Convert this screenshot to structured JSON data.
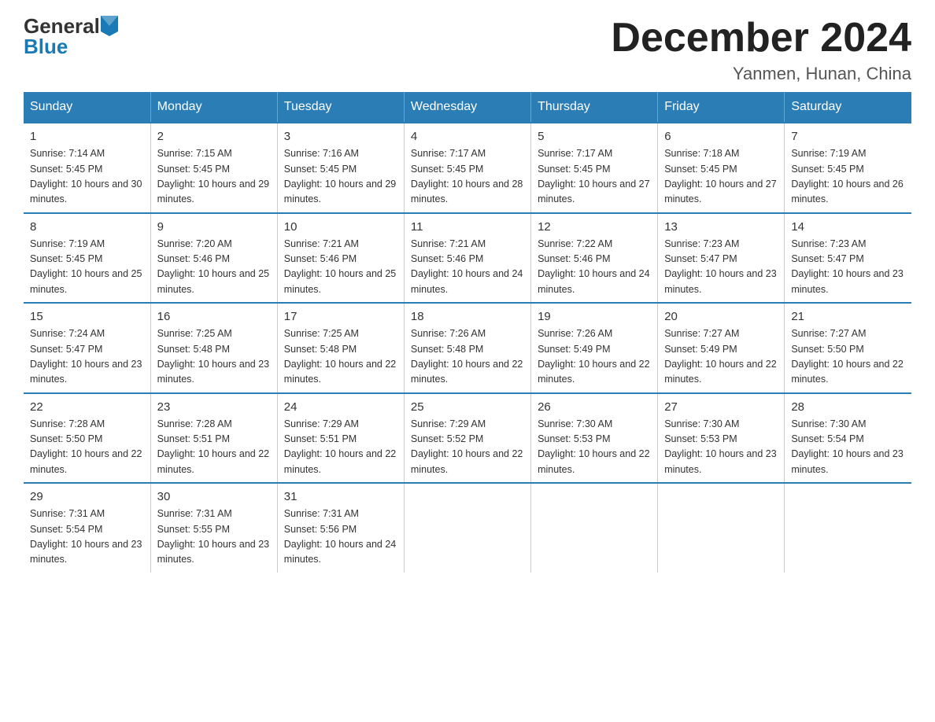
{
  "header": {
    "logo_general": "General",
    "logo_blue": "Blue",
    "main_title": "December 2024",
    "subtitle": "Yanmen, Hunan, China"
  },
  "days_of_week": [
    "Sunday",
    "Monday",
    "Tuesday",
    "Wednesday",
    "Thursday",
    "Friday",
    "Saturday"
  ],
  "weeks": [
    [
      {
        "day": "1",
        "sunrise": "7:14 AM",
        "sunset": "5:45 PM",
        "daylight": "10 hours and 30 minutes."
      },
      {
        "day": "2",
        "sunrise": "7:15 AM",
        "sunset": "5:45 PM",
        "daylight": "10 hours and 29 minutes."
      },
      {
        "day": "3",
        "sunrise": "7:16 AM",
        "sunset": "5:45 PM",
        "daylight": "10 hours and 29 minutes."
      },
      {
        "day": "4",
        "sunrise": "7:17 AM",
        "sunset": "5:45 PM",
        "daylight": "10 hours and 28 minutes."
      },
      {
        "day": "5",
        "sunrise": "7:17 AM",
        "sunset": "5:45 PM",
        "daylight": "10 hours and 27 minutes."
      },
      {
        "day": "6",
        "sunrise": "7:18 AM",
        "sunset": "5:45 PM",
        "daylight": "10 hours and 27 minutes."
      },
      {
        "day": "7",
        "sunrise": "7:19 AM",
        "sunset": "5:45 PM",
        "daylight": "10 hours and 26 minutes."
      }
    ],
    [
      {
        "day": "8",
        "sunrise": "7:19 AM",
        "sunset": "5:45 PM",
        "daylight": "10 hours and 25 minutes."
      },
      {
        "day": "9",
        "sunrise": "7:20 AM",
        "sunset": "5:46 PM",
        "daylight": "10 hours and 25 minutes."
      },
      {
        "day": "10",
        "sunrise": "7:21 AM",
        "sunset": "5:46 PM",
        "daylight": "10 hours and 25 minutes."
      },
      {
        "day": "11",
        "sunrise": "7:21 AM",
        "sunset": "5:46 PM",
        "daylight": "10 hours and 24 minutes."
      },
      {
        "day": "12",
        "sunrise": "7:22 AM",
        "sunset": "5:46 PM",
        "daylight": "10 hours and 24 minutes."
      },
      {
        "day": "13",
        "sunrise": "7:23 AM",
        "sunset": "5:47 PM",
        "daylight": "10 hours and 23 minutes."
      },
      {
        "day": "14",
        "sunrise": "7:23 AM",
        "sunset": "5:47 PM",
        "daylight": "10 hours and 23 minutes."
      }
    ],
    [
      {
        "day": "15",
        "sunrise": "7:24 AM",
        "sunset": "5:47 PM",
        "daylight": "10 hours and 23 minutes."
      },
      {
        "day": "16",
        "sunrise": "7:25 AM",
        "sunset": "5:48 PM",
        "daylight": "10 hours and 23 minutes."
      },
      {
        "day": "17",
        "sunrise": "7:25 AM",
        "sunset": "5:48 PM",
        "daylight": "10 hours and 22 minutes."
      },
      {
        "day": "18",
        "sunrise": "7:26 AM",
        "sunset": "5:48 PM",
        "daylight": "10 hours and 22 minutes."
      },
      {
        "day": "19",
        "sunrise": "7:26 AM",
        "sunset": "5:49 PM",
        "daylight": "10 hours and 22 minutes."
      },
      {
        "day": "20",
        "sunrise": "7:27 AM",
        "sunset": "5:49 PM",
        "daylight": "10 hours and 22 minutes."
      },
      {
        "day": "21",
        "sunrise": "7:27 AM",
        "sunset": "5:50 PM",
        "daylight": "10 hours and 22 minutes."
      }
    ],
    [
      {
        "day": "22",
        "sunrise": "7:28 AM",
        "sunset": "5:50 PM",
        "daylight": "10 hours and 22 minutes."
      },
      {
        "day": "23",
        "sunrise": "7:28 AM",
        "sunset": "5:51 PM",
        "daylight": "10 hours and 22 minutes."
      },
      {
        "day": "24",
        "sunrise": "7:29 AM",
        "sunset": "5:51 PM",
        "daylight": "10 hours and 22 minutes."
      },
      {
        "day": "25",
        "sunrise": "7:29 AM",
        "sunset": "5:52 PM",
        "daylight": "10 hours and 22 minutes."
      },
      {
        "day": "26",
        "sunrise": "7:30 AM",
        "sunset": "5:53 PM",
        "daylight": "10 hours and 22 minutes."
      },
      {
        "day": "27",
        "sunrise": "7:30 AM",
        "sunset": "5:53 PM",
        "daylight": "10 hours and 23 minutes."
      },
      {
        "day": "28",
        "sunrise": "7:30 AM",
        "sunset": "5:54 PM",
        "daylight": "10 hours and 23 minutes."
      }
    ],
    [
      {
        "day": "29",
        "sunrise": "7:31 AM",
        "sunset": "5:54 PM",
        "daylight": "10 hours and 23 minutes."
      },
      {
        "day": "30",
        "sunrise": "7:31 AM",
        "sunset": "5:55 PM",
        "daylight": "10 hours and 23 minutes."
      },
      {
        "day": "31",
        "sunrise": "7:31 AM",
        "sunset": "5:56 PM",
        "daylight": "10 hours and 24 minutes."
      },
      null,
      null,
      null,
      null
    ]
  ]
}
